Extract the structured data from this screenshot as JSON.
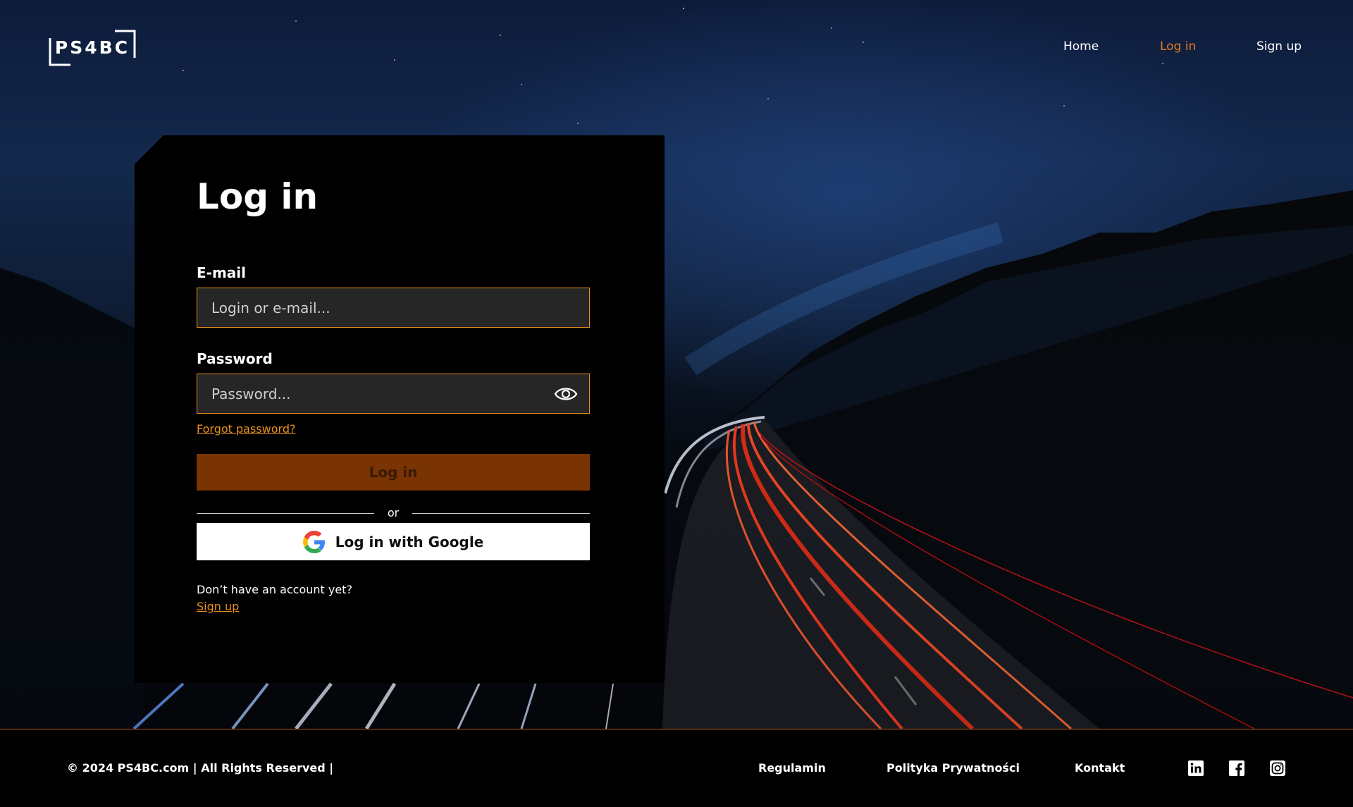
{
  "header": {
    "logo_text": "PS4BC",
    "nav": [
      {
        "label": "Home",
        "active": false
      },
      {
        "label": "Log in",
        "active": true
      },
      {
        "label": "Sign up",
        "active": false
      }
    ]
  },
  "login": {
    "title": "Log in",
    "email_label": "E-mail",
    "email_placeholder": "Login or e-mail...",
    "email_value": "",
    "password_label": "Password",
    "password_placeholder": "Password...",
    "password_value": "",
    "show_password_icon": "eye-icon",
    "forgot_label": "Forgot password?",
    "submit_label": "Log in",
    "divider_text": "or",
    "google_label": "Log in with Google",
    "google_icon": "google-icon",
    "no_account_text": "Don’t have an account yet?",
    "signup_label": "Sign up"
  },
  "footer": {
    "copyright": "© 2024 PS4BC.com | All Rights Reserved |",
    "links": [
      "Regulamin",
      "Polityka Prywatności",
      "Kontakt"
    ],
    "social": [
      "linkedin-icon",
      "facebook-icon",
      "instagram-icon"
    ]
  },
  "colors": {
    "accent": "#e8901e",
    "button": "#7a3303",
    "card_bg": "#000000",
    "input_bg": "#262626"
  }
}
